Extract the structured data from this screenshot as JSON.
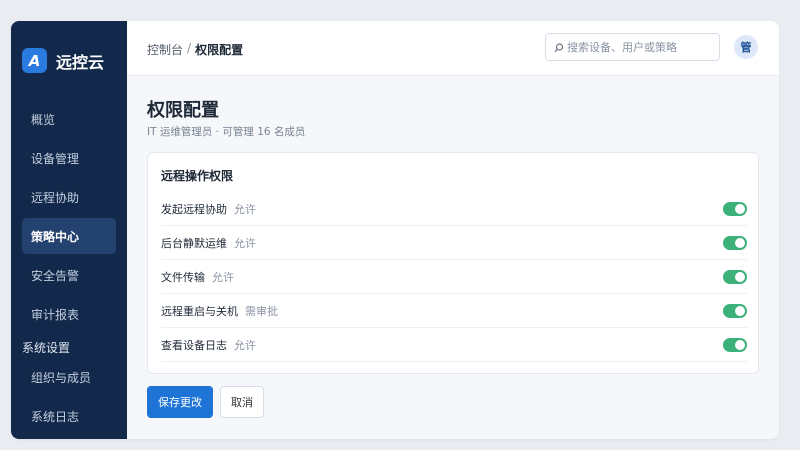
{
  "brand": {
    "logo_letter": "A",
    "name": "远控云",
    "accent": "#2a7be0"
  },
  "sidebar": {
    "items": [
      {
        "label": "概览"
      },
      {
        "label": "设备管理"
      },
      {
        "label": "远程协助"
      },
      {
        "label": "策略中心",
        "active": true
      },
      {
        "label": "安全告警"
      },
      {
        "label": "审计报表"
      }
    ],
    "group_label": "系统设置",
    "group_items": [
      {
        "label": "组织与成员"
      },
      {
        "label": "系统日志"
      }
    ]
  },
  "header": {
    "breadcrumb": {
      "parent": "控制台",
      "separator": "/",
      "current": "权限配置"
    },
    "search_placeholder": "搜索设备、用户或策略",
    "avatar": "管"
  },
  "main": {
    "title": "权限配置",
    "subtitle": "IT 运维管理员 · 可管理 16 名成员",
    "card": {
      "title": "远程操作权限",
      "rows": [
        {
          "name": "发起远程协助",
          "status": "允许",
          "enabled": true
        },
        {
          "name": "后台静默运维",
          "status": "允许",
          "enabled": true
        },
        {
          "name": "文件传输",
          "status": "允许",
          "enabled": true
        },
        {
          "name": "远程重启与关机",
          "status": "需审批",
          "enabled": true
        },
        {
          "name": "查看设备日志",
          "status": "允许",
          "enabled": true
        }
      ]
    },
    "save_label": "保存更改",
    "cancel_label": "取消"
  },
  "colors": {
    "sidebar_bg": "#13294b",
    "primary": "#1e73d6",
    "toggle_on": "#3cb179"
  }
}
